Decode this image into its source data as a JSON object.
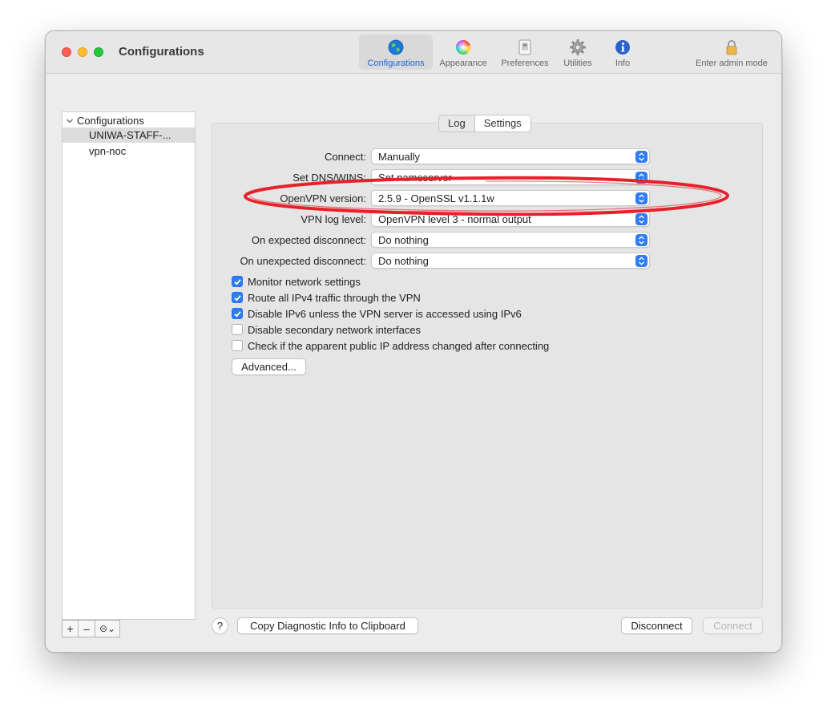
{
  "window": {
    "title": "Configurations"
  },
  "toolbar": {
    "items": [
      {
        "label": "Configurations",
        "icon": "globe-icon",
        "active": true
      },
      {
        "label": "Appearance",
        "icon": "color-wheel-icon",
        "active": false
      },
      {
        "label": "Preferences",
        "icon": "switch-icon",
        "active": false
      },
      {
        "label": "Utilities",
        "icon": "gear-icon",
        "active": false
      },
      {
        "label": "Info",
        "icon": "info-icon",
        "active": false
      }
    ],
    "admin_label": "Enter admin mode",
    "admin_icon": "lock-icon"
  },
  "sidebar": {
    "header": "Configurations",
    "items": [
      {
        "label": "UNIWA-STAFF-...",
        "selected": true
      },
      {
        "label": "vpn-noc",
        "selected": false
      }
    ],
    "buttons": {
      "add": "+",
      "remove": "–",
      "actions": "⊝⌄"
    }
  },
  "tabs": {
    "log": "Log",
    "settings": "Settings",
    "selected": "Settings"
  },
  "settings": {
    "rows": [
      {
        "label": "Connect:",
        "value": "Manually"
      },
      {
        "label": "Set DNS/WINS:",
        "value": "Set nameserver"
      },
      {
        "label": "OpenVPN version:",
        "value": "2.5.9 - OpenSSL v1.1.1w"
      },
      {
        "label": "VPN log level:",
        "value": "OpenVPN level 3 - normal output"
      },
      {
        "label": "On expected disconnect:",
        "value": "Do nothing"
      },
      {
        "label": "On unexpected disconnect:",
        "value": "Do nothing"
      }
    ],
    "checkboxes": [
      {
        "label": "Monitor network settings",
        "checked": true
      },
      {
        "label": "Route all IPv4 traffic through the VPN",
        "checked": true
      },
      {
        "label": "Disable IPv6 unless the VPN server is accessed using IPv6",
        "checked": true
      },
      {
        "label": "Disable secondary network interfaces",
        "checked": false
      },
      {
        "label": "Check if the apparent public IP address changed after connecting",
        "checked": false
      }
    ],
    "advanced_label": "Advanced..."
  },
  "footer": {
    "help": "?",
    "copy_diagnostic": "Copy Diagnostic Info to Clipboard",
    "disconnect": "Disconnect",
    "connect": "Connect"
  },
  "colors": {
    "accent": "#2f7cf6",
    "annotation": "#e8202a"
  }
}
